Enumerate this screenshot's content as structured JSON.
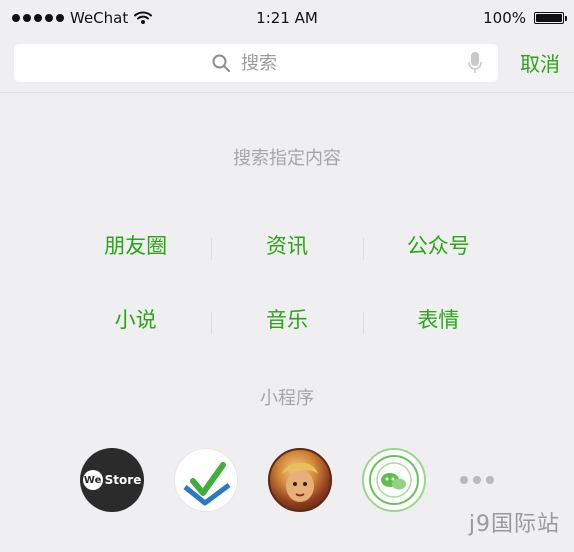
{
  "status_bar": {
    "carrier": "WeChat",
    "time": "1:21 AM",
    "battery_text": "100%",
    "battery_level": 1.0
  },
  "search": {
    "placeholder": "搜索",
    "cancel_label": "取消",
    "icons": {
      "search": "search-icon",
      "mic": "mic-icon"
    }
  },
  "section": {
    "title": "搜索指定内容",
    "rows": [
      [
        "朋友圈",
        "资讯",
        "公众号"
      ],
      [
        "小说",
        "音乐",
        "表情"
      ]
    ]
  },
  "miniapps": {
    "title": "小程序",
    "apps": [
      {
        "name": "we-store-app",
        "icon": "we-store-logo",
        "logo_text": "We Store",
        "logo_short": "We",
        "logo_word": "Store"
      },
      {
        "name": "checklist-app",
        "icon": "checkmark-logo"
      },
      {
        "name": "hero-game-app",
        "icon": "hero-portrait-logo"
      },
      {
        "name": "wechat-green-app",
        "icon": "wechat-open-class-seal-logo"
      }
    ],
    "more_icon": "more-dots-icon"
  },
  "watermark": {
    "text": "j9国际站"
  },
  "colors": {
    "accent": "#2aa515",
    "section_title": "#a6a6a6",
    "background": "#efeff1"
  }
}
